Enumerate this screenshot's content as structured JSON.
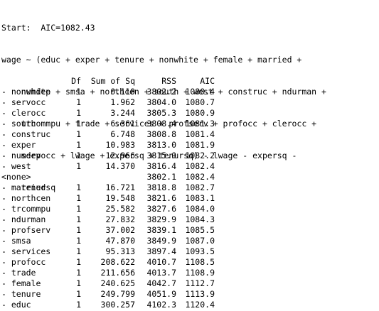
{
  "header": {
    "start_line": "Start:  AIC=1082.43",
    "formula_lines": [
      "wage ~ (educ + exper + tenure + nonwhite + female + married +",
      "    numdep + smsa + northcen + south + west + construc + ndurman +",
      "    trcommpu + trade + services + profserv + profocc + clerocc +",
      "    servocc + lwage + expersq + tenursq) - lwage - expersq -",
      "    tenursq"
    ]
  },
  "table": {
    "columns": [
      "",
      "Df",
      "Sum of Sq",
      "RSS",
      "AIC"
    ],
    "rows": [
      [
        "- nonwhite",
        "1",
        "0.110",
        "3802.2",
        "1080.4"
      ],
      [
        "- servocc",
        "1",
        "1.962",
        "3804.0",
        "1080.7"
      ],
      [
        "- clerocc",
        "1",
        "3.244",
        "3805.3",
        "1080.9"
      ],
      [
        "- south",
        "1",
        "6.361",
        "3808.4",
        "1081.3"
      ],
      [
        "- construc",
        "1",
        "6.748",
        "3808.8",
        "1081.4"
      ],
      [
        "- exper",
        "1",
        "10.983",
        "3813.0",
        "1081.9"
      ],
      [
        "- numdep",
        "1",
        "12.966",
        "3815.0",
        "1082.2"
      ],
      [
        "- west",
        "1",
        "14.370",
        "3816.4",
        "1082.4"
      ],
      [
        "<none>",
        "",
        "",
        "3802.1",
        "1082.4"
      ],
      [
        "- married",
        "1",
        "16.721",
        "3818.8",
        "1082.7"
      ],
      [
        "- northcen",
        "1",
        "19.548",
        "3821.6",
        "1083.1"
      ],
      [
        "- trcommpu",
        "1",
        "25.582",
        "3827.6",
        "1084.0"
      ],
      [
        "- ndurman",
        "1",
        "27.832",
        "3829.9",
        "1084.3"
      ],
      [
        "- profserv",
        "1",
        "37.002",
        "3839.1",
        "1085.5"
      ],
      [
        "- smsa",
        "1",
        "47.870",
        "3849.9",
        "1087.0"
      ],
      [
        "- services",
        "1",
        "95.313",
        "3897.4",
        "1093.5"
      ],
      [
        "- profocc",
        "1",
        "208.622",
        "4010.7",
        "1108.5"
      ],
      [
        "- trade",
        "1",
        "211.656",
        "4013.7",
        "1108.9"
      ],
      [
        "- female",
        "1",
        "240.625",
        "4042.7",
        "1112.7"
      ],
      [
        "- tenure",
        "1",
        "249.799",
        "4051.9",
        "1113.9"
      ],
      [
        "- educ",
        "1",
        "300.257",
        "4102.3",
        "1120.4"
      ]
    ]
  }
}
